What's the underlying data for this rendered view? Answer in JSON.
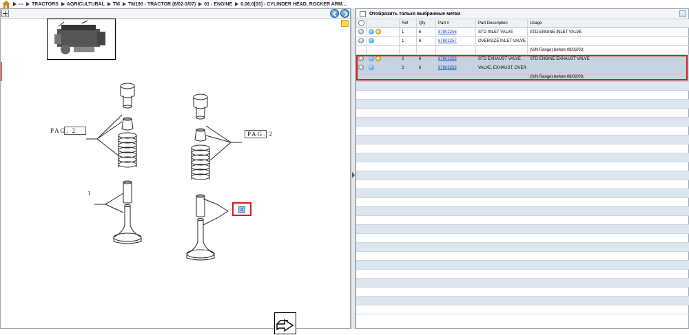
{
  "breadcrumb": {
    "items": [
      "---",
      "TRACTORS",
      "AGRICULTURAL",
      "TM",
      "TM190 - TRACTOR (6/02-3/07)",
      "01 - ENGINE",
      "0.06.0[03] - CYLINDER HEAD, ROCKER ARM..."
    ]
  },
  "drawing": {
    "pag_left": "PAG. 2",
    "pag_right": "PAG. 2",
    "ref_1": "1",
    "ref_2": "2"
  },
  "parts_panel": {
    "filter_label": "Отобразить только выбранные метки",
    "columns": [
      "",
      "Ref",
      "Qty",
      "Part #",
      "Part Description",
      "Usage"
    ],
    "rows": [
      {
        "ref": "1",
        "qty": "6",
        "part": "87802256",
        "desc": "STD INLET VALVE",
        "usage": "STD ENGINE INLET VALVE",
        "icons": [
          "info",
          "hand",
          "note"
        ]
      },
      {
        "ref": "1",
        "qty": "6",
        "part": "87802257",
        "desc": "OVERSIZE INLET VALVE",
        "usage": "",
        "icons": [
          "info",
          "hand"
        ]
      },
      {
        "ref": "",
        "qty": "",
        "part": "",
        "desc": "",
        "usage": "(S/N Range) before 09/02/03;",
        "icons": []
      },
      {
        "ref": "2",
        "qty": "6",
        "part": "87802258",
        "desc": "STD EXHAUST VALVE",
        "usage": "STD ENGINE EXHAUST VALVE",
        "icons": [
          "info",
          "hand",
          "note"
        ]
      },
      {
        "ref": "2",
        "qty": "6",
        "part": "87802259",
        "desc": "VALVE, EXHAUST, OVER",
        "usage": "",
        "icons": [
          "info",
          "hand"
        ]
      },
      {
        "ref": "",
        "qty": "",
        "part": "",
        "desc": "",
        "usage": "(S/N Range) before 09/02/03;",
        "icons": []
      }
    ]
  },
  "colors": {
    "selection_outline": "#e0141e",
    "link": "#1b3fc4"
  }
}
